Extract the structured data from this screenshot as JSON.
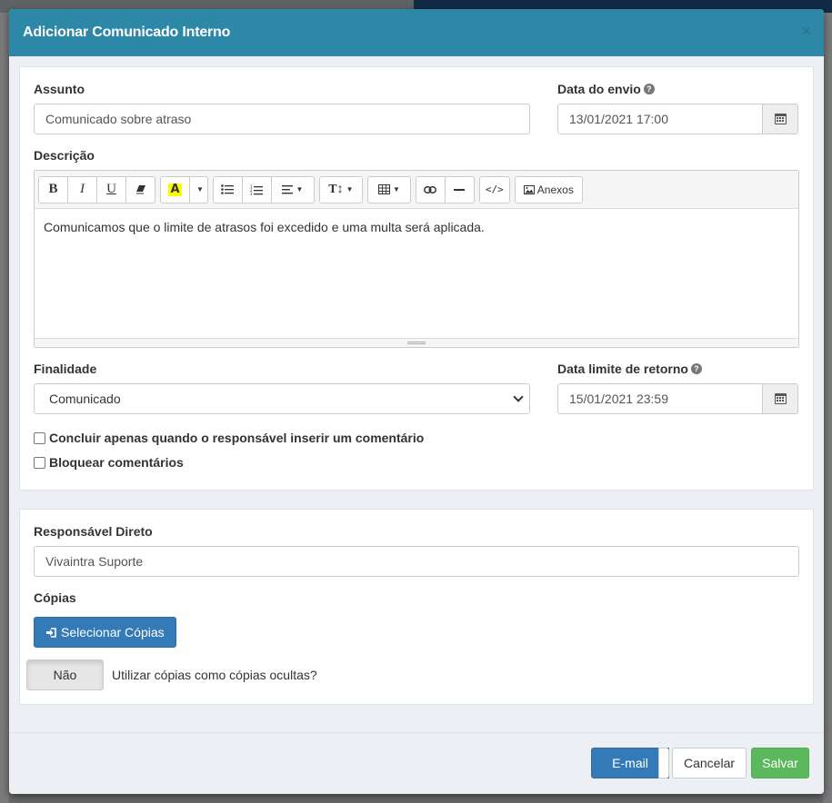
{
  "modal": {
    "title": "Adicionar Comunicado Interno",
    "close_icon": "close-icon"
  },
  "form": {
    "assunto": {
      "label": "Assunto",
      "value": "Comunicado sobre atraso"
    },
    "data_envio": {
      "label": "Data do envio",
      "value": "13/01/2021 17:00",
      "help_icon": "question-circle-icon",
      "addon_icon": "calendar-icon"
    },
    "descricao": {
      "label": "Descrição",
      "content": "Comunicamos que o limite de atrasos foi excedido e uma multa será aplicada.",
      "toolbar": {
        "bold": "B",
        "italic": "I",
        "underline": "U",
        "eraser_icon": "eraser-icon",
        "color_letter": "A",
        "ul_icon": "unordered-list-icon",
        "ol_icon": "ordered-list-icon",
        "align_icon": "align-left-icon",
        "font_size": "T↕",
        "table_icon": "table-icon",
        "link_icon": "link-icon",
        "hr_icon": "horizontal-rule-icon",
        "code": "</>",
        "anexos": "Anexos"
      }
    },
    "finalidade": {
      "label": "Finalidade",
      "selected": "Comunicado"
    },
    "data_limite": {
      "label": "Data limite de retorno",
      "value": "15/01/2021 23:59"
    },
    "concluir_checkbox": {
      "label": "Concluir apenas quando o responsável inserir um comentário",
      "checked": false
    },
    "bloquear_checkbox": {
      "label": "Bloquear comentários",
      "checked": false
    }
  },
  "responsaveis": {
    "responsavel_label": "Responsável Direto",
    "responsavel_value": "Vivaintra Suporte",
    "copias_label": "Cópias",
    "selecionar_button": "Selecionar Cópias",
    "ocultas_toggle": "Não",
    "ocultas_text": "Utilizar cópias como cópias ocultas?"
  },
  "footer": {
    "email_button": "E-mail",
    "cancel_button": "Cancelar",
    "save_button": "Salvar"
  },
  "colors": {
    "header": "#2d87a6",
    "primary": "#337ab7",
    "success": "#5cb85c"
  }
}
